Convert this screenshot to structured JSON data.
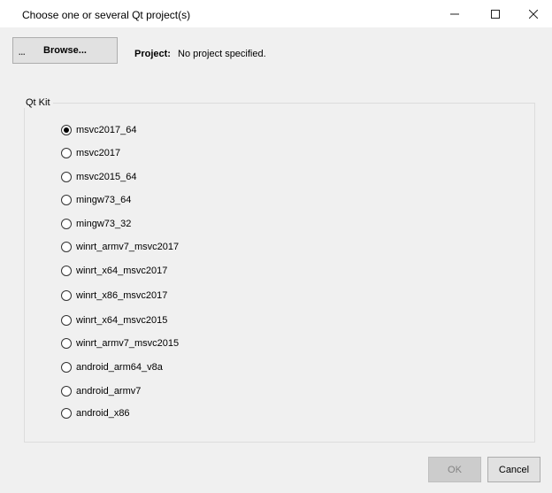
{
  "window": {
    "title": "Choose one or several Qt project(s)",
    "controls": {
      "minimize_icon": "minimize-icon",
      "maximize_icon": "maximize-icon",
      "close_icon": "close-icon"
    }
  },
  "toolbar": {
    "browse_label": "Browse...",
    "browse_prefix": "...",
    "project_label": "Project:",
    "project_value": "No project specified."
  },
  "qt_kit": {
    "legend": "Qt Kit",
    "selected": "msvc2017_64",
    "options": [
      {
        "label": "msvc2017_64",
        "checked": true
      },
      {
        "label": "msvc2017",
        "checked": false
      },
      {
        "label": "msvc2015_64",
        "checked": false
      },
      {
        "label": "mingw73_64",
        "checked": false
      },
      {
        "label": "mingw73_32",
        "checked": false
      },
      {
        "label": "winrt_armv7_msvc2017",
        "checked": false
      },
      {
        "label": "winrt_x64_msvc2017",
        "checked": false
      },
      {
        "label": "winrt_x86_msvc2017",
        "checked": false
      },
      {
        "label": "winrt_x64_msvc2015",
        "checked": false
      },
      {
        "label": "winrt_armv7_msvc2015",
        "checked": false
      },
      {
        "label": "android_arm64_v8a",
        "checked": false
      },
      {
        "label": "android_armv7",
        "checked": false
      },
      {
        "label": "android_x86",
        "checked": false
      }
    ]
  },
  "footer": {
    "ok_label": "OK",
    "ok_enabled": false,
    "cancel_label": "Cancel"
  },
  "colors": {
    "window_bg": "#f0f0f0",
    "titlebar_bg": "#ffffff",
    "button_bg": "#e1e1e1",
    "disabled_text": "#838383"
  }
}
